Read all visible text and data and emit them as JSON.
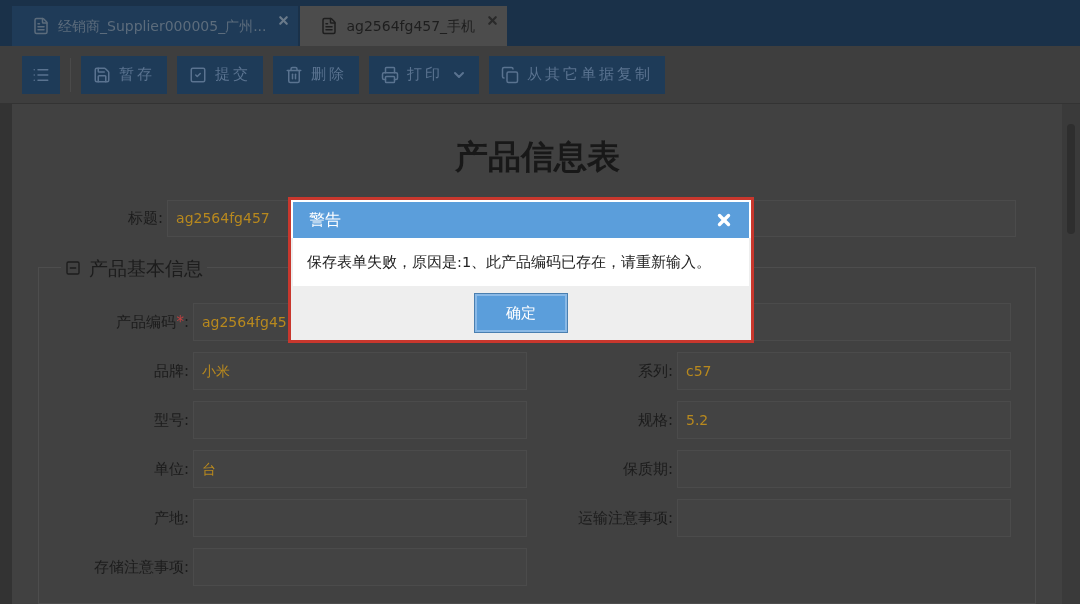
{
  "tabs": [
    {
      "label": "经销商_Supplier000005_广州...",
      "selected": false
    },
    {
      "label": "ag2564fg457_手机",
      "selected": true
    }
  ],
  "toolbar": [
    {
      "kind": "menu"
    },
    {
      "kind": "save",
      "label": "暂存"
    },
    {
      "kind": "submit",
      "label": "提交"
    },
    {
      "kind": "delete",
      "label": "删除"
    },
    {
      "kind": "print",
      "label": "打印"
    },
    {
      "kind": "copy",
      "label": "从其它单据复制"
    }
  ],
  "form_title": "产品信息表",
  "title_field": {
    "label": "标题:",
    "value": "ag2564fg457"
  },
  "section": {
    "title": "产品基本信息",
    "expanded": true,
    "rows": [
      [
        {
          "label": "产品编码",
          "required": true,
          "mark": "*",
          "colon": ":",
          "value": "ag2564fg45"
        },
        {}
      ],
      [
        {
          "label": "品牌:",
          "value": "小米"
        },
        {
          "label": "系列:",
          "value": "c57"
        }
      ],
      [
        {
          "label": "型号:"
        },
        {
          "label": "规格:",
          "value": "5.2"
        }
      ],
      [
        {
          "label": "单位:",
          "value": "台"
        },
        {
          "label": "保质期:"
        }
      ],
      [
        {
          "label": "产地:"
        },
        {
          "label": "运输注意事项:"
        }
      ],
      [
        {
          "label": "存储注意事项:"
        },
        null
      ]
    ]
  },
  "dialog": {
    "title": "警告",
    "message": "保存表单失败，原因是:1、此产品编码已存在，请重新输入。",
    "button": "确定"
  }
}
